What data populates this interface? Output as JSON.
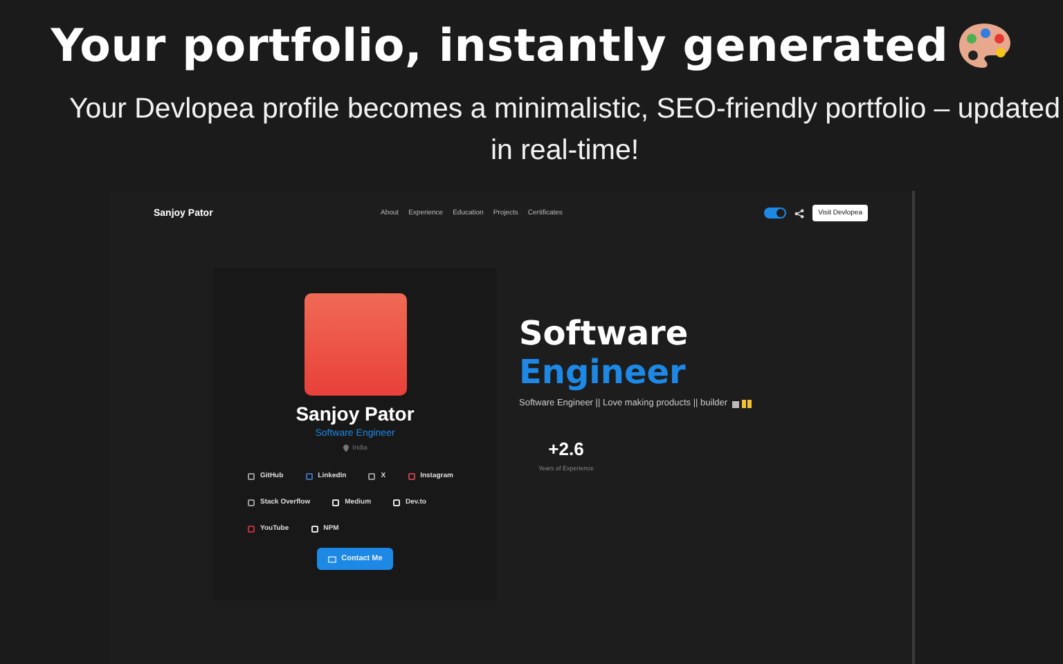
{
  "headline": "Your portfolio, instantly generated",
  "subtitle": "Your Devlopea profile becomes a minimalistic, SEO-friendly portfolio – updated in real-time!",
  "preview": {
    "brand": "Sanjoy Pator",
    "nav": [
      "About",
      "Experience",
      "Education",
      "Projects",
      "Certificates"
    ],
    "theme_toggle": {
      "on": true
    },
    "visit_button": "Visit Devlopea",
    "profile": {
      "name": "Sanjoy Pator",
      "role": "Software Engineer",
      "location": "India",
      "links": [
        {
          "label": "GitHub",
          "color": "#9a9a9a"
        },
        {
          "label": "LinkedIn",
          "color": "#3b6fb0"
        },
        {
          "label": "X",
          "color": "#9a9a9a"
        },
        {
          "label": "Instagram",
          "color": "#c0404a"
        },
        {
          "label": "Stack Overflow",
          "color": "#9a9a9a"
        },
        {
          "label": "Medium",
          "color": "#e8e8e8"
        },
        {
          "label": "Dev.to",
          "color": "#e8e8e8"
        },
        {
          "label": "YouTube",
          "color": "#c0303a"
        },
        {
          "label": "NPM",
          "color": "#e8e8e8"
        }
      ],
      "contact_button": "Contact Me"
    },
    "hero": {
      "title_line_1": "Software",
      "title_line_2": "Engineer",
      "tagline": "Software Engineer || Love making products || builder",
      "stat_value": "+2.6",
      "stat_label": "Years of Experience"
    }
  }
}
